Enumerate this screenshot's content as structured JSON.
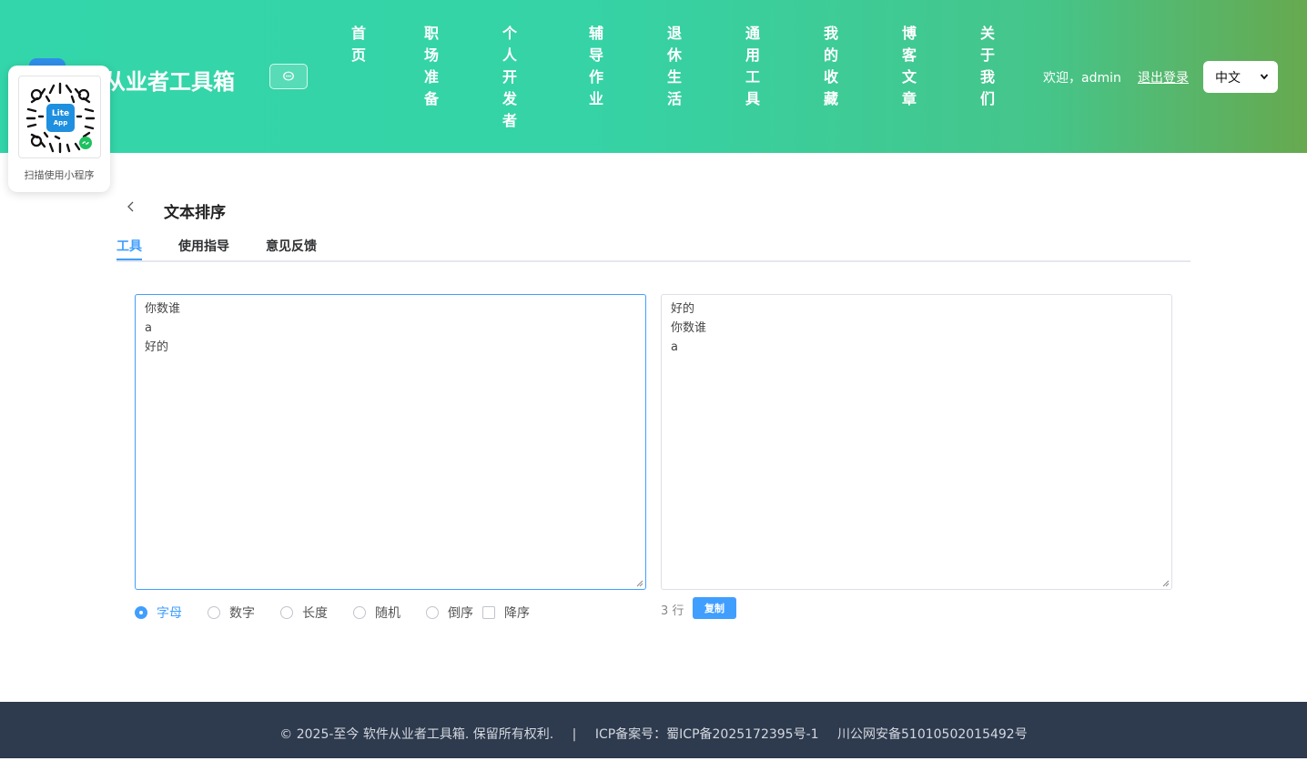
{
  "header": {
    "brand_title": "件从业者工具箱",
    "nav": [
      {
        "label": "首页"
      },
      {
        "label": "职场准备"
      },
      {
        "label": "个人开发者"
      },
      {
        "label": "辅导作业"
      },
      {
        "label": "退休生活"
      },
      {
        "label": "通用工具"
      },
      {
        "label": "我的收藏"
      },
      {
        "label": "博客文章"
      },
      {
        "label": "关于我们"
      }
    ],
    "welcome": "欢迎，admin",
    "logout": "退出登录",
    "language": "中文"
  },
  "qr_popup": {
    "logo_text_1": "Lite",
    "logo_text_2": "App",
    "caption": "扫描使用小程序"
  },
  "page": {
    "title": "文本排序",
    "tabs": [
      {
        "label": "工具"
      },
      {
        "label": "使用指导"
      },
      {
        "label": "意见反馈"
      }
    ]
  },
  "tool": {
    "input_lines": [
      "你数谁",
      "a",
      "好的"
    ],
    "output_lines": [
      "好的",
      "你数谁",
      "a"
    ],
    "sort_options": [
      {
        "label": "字母",
        "checked": true
      },
      {
        "label": "数字",
        "checked": false
      },
      {
        "label": "长度",
        "checked": false
      },
      {
        "label": "随机",
        "checked": false
      },
      {
        "label": "倒序",
        "checked": false
      }
    ],
    "descending_label": "降序",
    "descending_checked": false,
    "line_count": "3 行",
    "copy_label": "复制"
  },
  "footer": {
    "copyright": "© 2025-至今 软件从业者工具箱. 保留所有权利.",
    "separator": "|",
    "icp": "ICP备案号：蜀ICP备2025172395号-1",
    "police": "川公网安备51010502015492号"
  },
  "colors": {
    "accent": "#409eff",
    "header_start": "#33d6aa",
    "header_end": "#67a94f",
    "footer_bg": "#2e3a4d"
  }
}
